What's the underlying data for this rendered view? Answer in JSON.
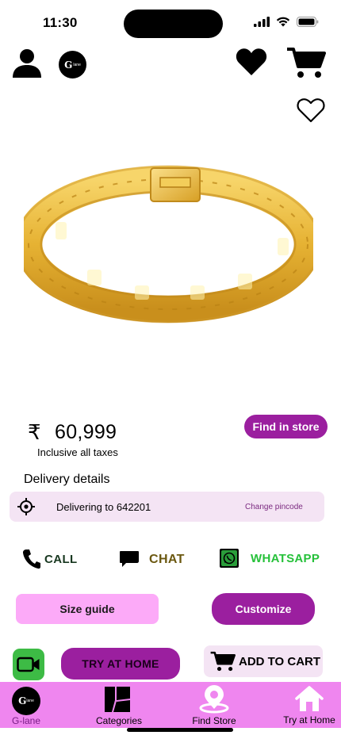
{
  "status": {
    "time": "11:30"
  },
  "header": {
    "logo_text": "G",
    "logo_sub": "lane"
  },
  "product": {
    "currency_symbol": "₹",
    "price": "60,999",
    "tax_note": "Inclusive all taxes",
    "find_in_store": "Find in store"
  },
  "delivery": {
    "title": "Delivery details",
    "text": "Delivering to 642201",
    "change_label": "Change pincode"
  },
  "contact": {
    "call": "CALL",
    "chat": "CHAT",
    "whatsapp": "WHATSAPP"
  },
  "actions": {
    "size_guide": "Size guide",
    "customize": "Customize",
    "try_at_home": "TRY AT HOME",
    "add_to_cart": "ADD TO CART"
  },
  "nav": {
    "items": [
      {
        "label": "G-lane"
      },
      {
        "label": "Categories"
      },
      {
        "label": "Find Store"
      },
      {
        "label": "Try at Home"
      }
    ]
  },
  "colors": {
    "brand_purple": "#9b1f9f",
    "nav_pink": "#ef86ef",
    "light_pink": "#fcaaf8",
    "whatsapp_green": "#26c13a"
  }
}
